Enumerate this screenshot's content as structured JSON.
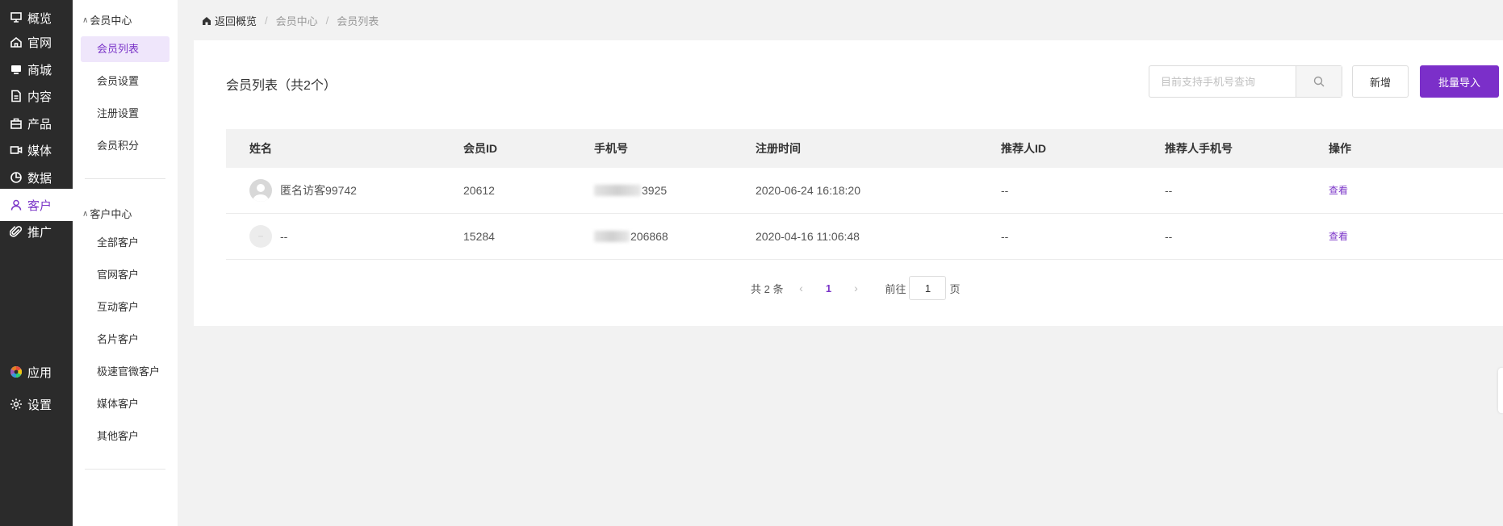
{
  "nav": {
    "items": [
      {
        "label": "概览",
        "icon": "overview-icon"
      },
      {
        "label": "官网",
        "icon": "home-icon"
      },
      {
        "label": "商城",
        "icon": "shop-icon"
      },
      {
        "label": "内容",
        "icon": "document-icon"
      },
      {
        "label": "产品",
        "icon": "product-icon"
      },
      {
        "label": "媒体",
        "icon": "video-icon"
      },
      {
        "label": "数据",
        "icon": "chart-icon"
      },
      {
        "label": "客户",
        "icon": "user-icon",
        "active": true
      },
      {
        "label": "推广",
        "icon": "paperclip-icon"
      },
      {
        "label": "应用",
        "icon": "apps-icon"
      },
      {
        "label": "设置",
        "icon": "gear-icon"
      }
    ]
  },
  "subnav": {
    "member_group": "会员中心",
    "member_items": [
      "会员列表",
      "会员设置",
      "注册设置",
      "会员积分"
    ],
    "customer_group": "客户中心",
    "customer_items": [
      "全部客户",
      "官网客户",
      "互动客户",
      "名片客户",
      "极速官微客户",
      "媒体客户",
      "其他客户"
    ]
  },
  "breadcrumb": {
    "home": "返回概览",
    "items": [
      "会员中心",
      "会员列表"
    ]
  },
  "card": {
    "title": "会员列表（共2个）",
    "search_placeholder": "目前支持手机号查询",
    "add_label": "新增",
    "import_label": "批量导入"
  },
  "table": {
    "columns": [
      "姓名",
      "会员ID",
      "手机号",
      "注册时间",
      "推荐人ID",
      "推荐人手机号",
      "操作"
    ],
    "rows": [
      {
        "name": "匿名访客99742",
        "id": "20612",
        "phone_visible": "3925",
        "registered": "2020-06-24 16:18:20",
        "referrer_id": "--",
        "referrer_phone": "--",
        "action": "查看"
      },
      {
        "name": "--",
        "id": "15284",
        "phone_visible": "206868",
        "registered": "2020-04-16 11:06:48",
        "referrer_id": "--",
        "referrer_phone": "--",
        "action": "查看"
      }
    ]
  },
  "pagination": {
    "total_text": "共 2 条",
    "prev": "‹",
    "current_page": "1",
    "next": "›",
    "goto_label": "前往",
    "goto_value": "1",
    "page_suffix": "页"
  },
  "colors": {
    "accent": "#7b2fc9",
    "sidebar_bg": "#2b2b2b"
  }
}
